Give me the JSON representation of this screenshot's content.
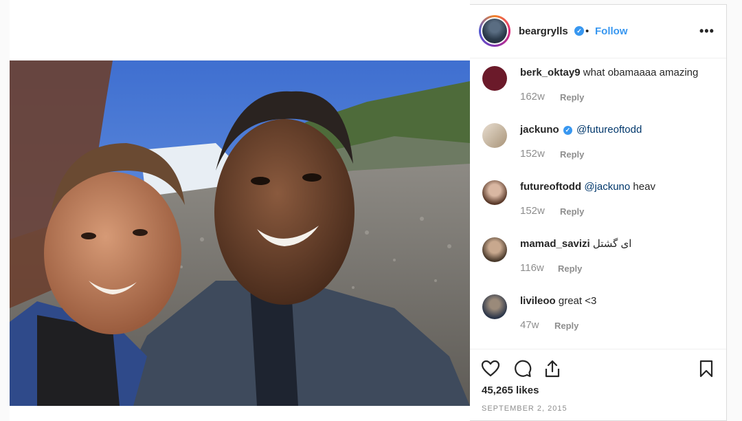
{
  "post": {
    "username": "beargrylls",
    "separator": "•",
    "follow_label": "Follow",
    "more_label": "•••",
    "likes": "45,265 likes",
    "date": "SEPTEMBER 2, 2015"
  },
  "photo": {
    "alt_description_icon": "photo-icon"
  },
  "comments": [
    {
      "username": "berk_oktay9",
      "verified": false,
      "mention": "",
      "text": "what obamaaaa amazing",
      "age": "162w",
      "reply_label": "Reply",
      "avatar_color": "#6b1a2a"
    },
    {
      "username": "jackuno",
      "verified": true,
      "mention": "@futureoftodd",
      "text": "",
      "age": "152w",
      "reply_label": "Reply",
      "avatar_color": "#c9b8a0"
    },
    {
      "username": "futureoftodd",
      "verified": false,
      "mention": "@jackuno",
      "text": "heav",
      "age": "152w",
      "reply_label": "Reply",
      "avatar_color": "#7c5a48"
    },
    {
      "username": "mamad_savizi",
      "verified": false,
      "mention": "",
      "text": "ای گشتل",
      "age": "116w",
      "reply_label": "Reply",
      "avatar_color": "#5b4a3a"
    },
    {
      "username": "livileoo",
      "verified": false,
      "mention": "",
      "text": "great <3",
      "age": "47w",
      "reply_label": "Reply",
      "avatar_color": "#2b3548"
    }
  ],
  "icons": {
    "like": "heart-icon",
    "comment": "comment-icon",
    "share": "share-icon",
    "save": "bookmark-icon",
    "verified": "verified-badge-icon",
    "more": "more-options-icon"
  },
  "colors": {
    "link": "#3897f0",
    "mention": "#00376b",
    "muted": "#8e8e8e",
    "text": "#262626"
  }
}
